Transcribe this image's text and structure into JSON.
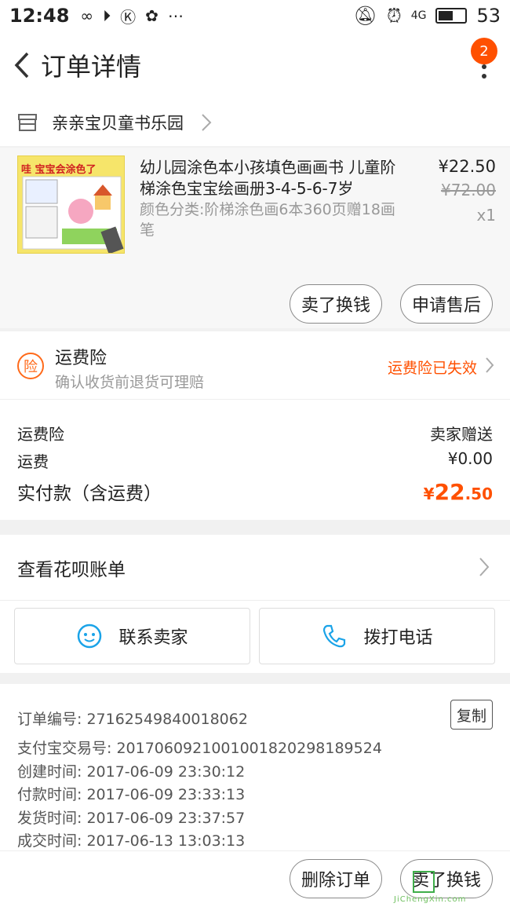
{
  "status_bar": {
    "time": "12:48",
    "network": "4G",
    "battery": "53"
  },
  "header": {
    "title": "订单详情",
    "badge_count": "2"
  },
  "shop": {
    "name": "亲亲宝贝童书乐园"
  },
  "product": {
    "image_title": "哇 宝宝会涂色了",
    "name": "幼儿园涂色本小孩填色画画书 儿童阶梯涂色宝宝绘画册3-4-5-6-7岁",
    "sku": "颜色分类:阶梯涂色画6本360页赠18画笔",
    "price": "¥22.50",
    "original_price": "¥72.00",
    "quantity": "x1",
    "buttons": {
      "resell": "卖了换钱",
      "after_sale": "申请售后"
    }
  },
  "insurance": {
    "icon_char": "险",
    "title": "运费险",
    "desc": "确认收货前退货可理赔",
    "status": "运费险已失效",
    "status_color": "#ff5000"
  },
  "summary": {
    "insurance_label": "运费险",
    "insurance_value": "卖家赠送",
    "shipping_label": "运费",
    "shipping_value": "¥0.00",
    "total_label": "实付款（含运费）",
    "total_symbol": "¥",
    "total_int": "22",
    "total_dec": ".50"
  },
  "huabei": {
    "label": "查看花呗账单"
  },
  "actions": {
    "contact_seller": "联系卖家",
    "call": "拨打电话"
  },
  "order_info": {
    "order_no": "订单编号: 2716254984001806​2",
    "copy_label": "复制",
    "alipay_no": "支付宝交易号: 2017060921001001820298189524",
    "created": "创建时间: 2017-06-09 23:30:12",
    "paid": "付款时间: 2017-06-09 23:33:13",
    "shipped": "发货时间: 2017-06-09 23:37:57",
    "completed": "成交时间: 2017-06-13 13:03:13"
  },
  "footer": {
    "delete_order": "删除订单",
    "resell": "卖了换钱"
  },
  "watermark": {
    "text": "JiChengXin.com"
  },
  "colors": {
    "accent": "#ff5000",
    "link_blue": "#1aa3e8"
  }
}
